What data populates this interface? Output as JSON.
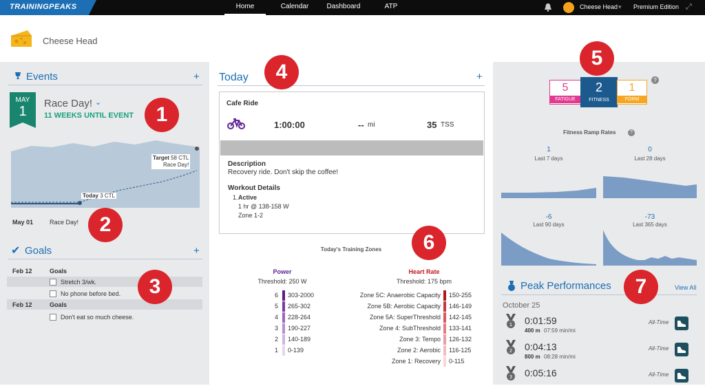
{
  "nav": {
    "logo": "TRAININGPEAKS",
    "tabs": [
      {
        "label": "Home"
      },
      {
        "label": "Calendar"
      },
      {
        "label": "Dashboard"
      },
      {
        "label": "ATP"
      }
    ],
    "user": "Cheese Head",
    "edition": "Premium Edition",
    "icons": [
      "bell-icon",
      "avatar",
      "chevron-down-icon",
      "expand-icon"
    ]
  },
  "header": {
    "name": "Cheese Head",
    "avatar_icon": "cheese-icon"
  },
  "callouts": [
    "1",
    "2",
    "3",
    "4",
    "5",
    "6",
    "7"
  ],
  "events": {
    "title": "Events",
    "add": "+",
    "month": "MAY",
    "day": "1",
    "event_name": "Race Day!",
    "countdown": "11 WEEKS UNTIL EVENT",
    "target_label": "Target",
    "target_value": "58 CTL",
    "target_event": "Race Day!",
    "today_label": "Today",
    "today_value": "3 CTL",
    "list_date": "May 01",
    "list_name": "Race Day!"
  },
  "goals": {
    "title": "Goals",
    "add": "+",
    "groups": [
      {
        "date": "Feb 12",
        "label": "Goals",
        "items": [
          "Stretch 3/wk.",
          "No phone before bed."
        ]
      },
      {
        "date": "Feb 12",
        "label": "Goals",
        "items": [
          "Don't eat so much cheese."
        ]
      }
    ]
  },
  "today": {
    "title": "Today",
    "add": "+",
    "workout_title": "Cafe Ride",
    "sport_icon": "bike-icon",
    "duration": "1:00:00",
    "distance": "--",
    "distance_unit": "mi",
    "tss": "35",
    "tss_unit": "TSS",
    "description_label": "Description",
    "description": "Recovery ride. Don't skip the coffee!",
    "details_label": "Workout Details",
    "step_index": "1.",
    "step_name": "Active",
    "step_line1": "1 hr @ 138-158 W",
    "step_line2": "Zone 1-2"
  },
  "zones": {
    "title": "Today's Training Zones",
    "power": {
      "title": "Power",
      "threshold": "Threshold: 250 W",
      "rows": [
        {
          "num": "6",
          "range": "303-2000",
          "color": "#5e1a8c"
        },
        {
          "num": "5",
          "range": "265-302",
          "color": "#7a3aa6"
        },
        {
          "num": "4",
          "range": "228-264",
          "color": "#9a66bf"
        },
        {
          "num": "3",
          "range": "190-227",
          "color": "#b48fd1"
        },
        {
          "num": "2",
          "range": "140-189",
          "color": "#cdb4e2"
        },
        {
          "num": "1",
          "range": "0-139",
          "color": "#e4d8f0"
        }
      ]
    },
    "hr": {
      "title": "Heart Rate",
      "threshold": "Threshold: 175 bpm",
      "rows": [
        {
          "name": "Zone 5C: Anaerobic Capacity",
          "range": "150-255",
          "color": "#b3141c"
        },
        {
          "name": "Zone 5B: Aerobic Capacity",
          "range": "146-149",
          "color": "#c9373d"
        },
        {
          "name": "Zone 5A: SuperThreshold",
          "range": "142-145",
          "color": "#d75a5f"
        },
        {
          "name": "Zone 4: SubThreshold",
          "range": "133-141",
          "color": "#e07d80"
        },
        {
          "name": "Zone 3: Tempo",
          "range": "126-132",
          "color": "#e99ea0"
        },
        {
          "name": "Zone 2: Aerobic",
          "range": "116-125",
          "color": "#f0bdbe"
        },
        {
          "name": "Zone 1: Recovery",
          "range": "0-115",
          "color": "#f6d8d9"
        }
      ]
    }
  },
  "fitness": {
    "fatigue_value": "5",
    "fatigue_label": "FATIGUE",
    "fitness_value": "2",
    "fitness_label": "FITNESS",
    "form_value": "1",
    "form_label": "FORM",
    "colors": {
      "fatigue": "#e0398f",
      "fitness": "#1c5a8e",
      "form": "#f5a623"
    },
    "ramp_title": "Fitness Ramp Rates",
    "ramps": [
      {
        "value": "1",
        "label": "Last 7 days"
      },
      {
        "value": "0",
        "label": "Last 28 days"
      },
      {
        "value": "-6",
        "label": "Last 90 days"
      },
      {
        "value": "-73",
        "label": "Last 365 days"
      }
    ]
  },
  "peak": {
    "title": "Peak Performances",
    "view_all": "View All",
    "date": "October 25",
    "rows": [
      {
        "time": "0:01:59",
        "dist": "400 m",
        "pace": "07:59 min/mi",
        "tag": "All-Time"
      },
      {
        "time": "0:04:13",
        "dist": "800 m",
        "pace": "08:28 min/mi",
        "tag": "All-Time"
      },
      {
        "time": "0:05:16",
        "dist": "",
        "pace": "",
        "tag": "All-Time"
      }
    ]
  }
}
